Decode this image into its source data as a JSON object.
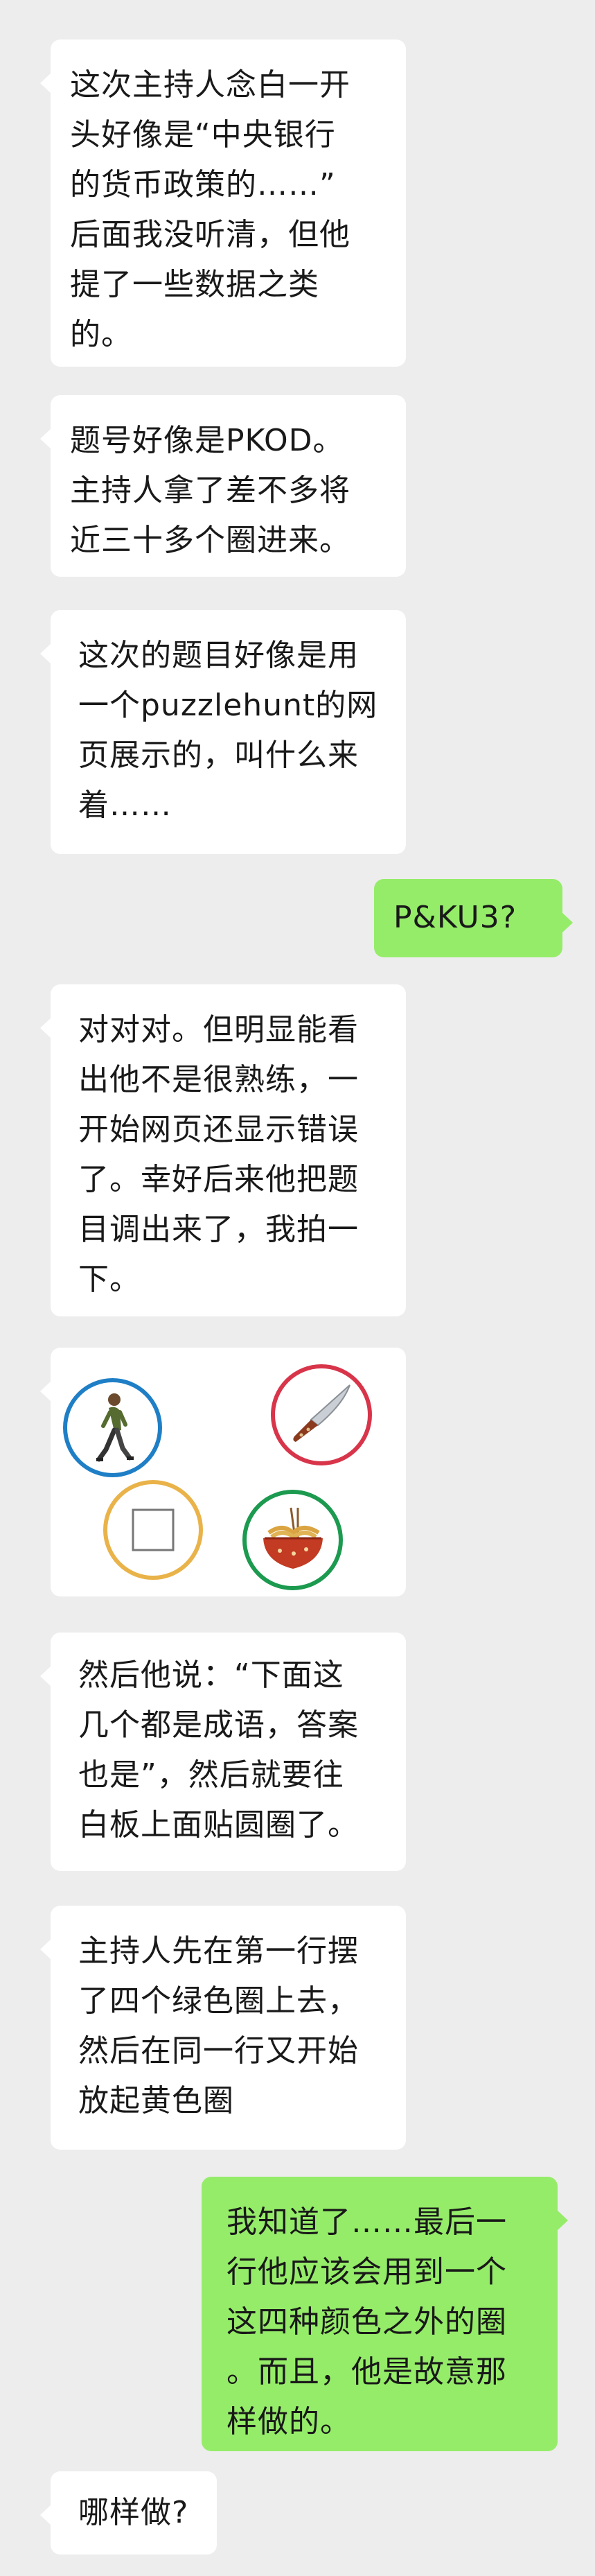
{
  "colors": {
    "background": "#ededed",
    "incoming_bubble": "#ffffff",
    "outgoing_bubble": "#95ec69",
    "text": "#191919",
    "circle_blue": "#1f7fc6",
    "circle_red": "#d8354a",
    "circle_yellow": "#e9b34a",
    "circle_green": "#1c9a4f"
  },
  "messages": [
    {
      "side": "left",
      "text": "这次主持人念白一开\n头好像是“中央银行\n的货币政策的……”\n后面我没听清，但他\n提了一些数据之类\n的。"
    },
    {
      "side": "left",
      "text": "题号好像是PKOD。\n主持人拿了差不多将\n近三十多个圈进来。"
    },
    {
      "side": "left",
      "text": "这次的题目好像是用\n一个puzzlehunt的网\n页展示的，叫什么来\n着……"
    },
    {
      "side": "right",
      "text": "P&KU3?"
    },
    {
      "side": "left",
      "text": "对对对。但明显能看\n出他不是很熟练，一\n开始网页还显示错误\n了。幸好后来他把题\n目调出来了，我拍一\n下。"
    },
    {
      "side": "left",
      "text": "然后他说：“下面这\n几个都是成语，答案\n也是”，然后就要往\n白板上面贴圆圈了。"
    },
    {
      "side": "left",
      "text": "主持人先在第一行摆\n了四个绿色圈上去，\n然后在同一行又开始\n放起黄色圈"
    },
    {
      "side": "right",
      "text": "我知道了……最后一\n行他应该会用到一个\n这四种颜色之外的圈\n。而且，他是故意那\n样做的。"
    },
    {
      "side": "left",
      "text": "哪样做?"
    }
  ],
  "photo": {
    "circles": [
      {
        "color": "blue",
        "icon": "walking-person-icon"
      },
      {
        "color": "red",
        "icon": "knife-icon"
      },
      {
        "color": "yellow",
        "icon": "empty-square-icon"
      },
      {
        "color": "green",
        "icon": "noodle-bowl-icon"
      }
    ]
  }
}
